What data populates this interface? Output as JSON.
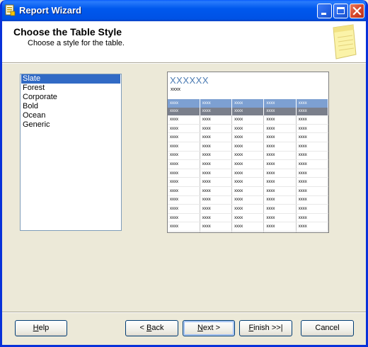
{
  "window": {
    "title": "Report Wizard",
    "controls": {
      "minimize": "minimize",
      "maximize": "maximize",
      "close": "close"
    }
  },
  "header": {
    "title": "Choose the Table Style",
    "subtitle": "Choose a style for the table.",
    "icon": "notepad-icon"
  },
  "styles": {
    "items": [
      "Slate",
      "Forest",
      "Corporate",
      "Bold",
      "Ocean",
      "Generic"
    ],
    "selected": "Slate"
  },
  "preview": {
    "title": "XXXXXX",
    "subtitle": "xxxx",
    "header_row": [
      "xxxx",
      "xxxx",
      "xxxx",
      "xxxx",
      "xxxx"
    ],
    "group_row": [
      "xxxx",
      "xxxx",
      "xxxx",
      "xxxx",
      "xxxx"
    ],
    "data_cell": "xxxx",
    "data_rows": 14,
    "colors": {
      "title": "#4b7bb3",
      "header": "#7da0d2",
      "group": "#7a7f8b"
    }
  },
  "buttons": {
    "help": {
      "accel": "H",
      "rest": "elp"
    },
    "back": {
      "pre": "< ",
      "accel": "B",
      "rest": "ack"
    },
    "next": {
      "accel": "N",
      "rest": "ext >"
    },
    "finish": {
      "accel": "F",
      "rest": "inish >>|"
    },
    "cancel": "Cancel"
  },
  "colors": {
    "titlebar": "#0058ee",
    "selection": "#316ac5",
    "dialog_bg": "#ece9d8"
  }
}
